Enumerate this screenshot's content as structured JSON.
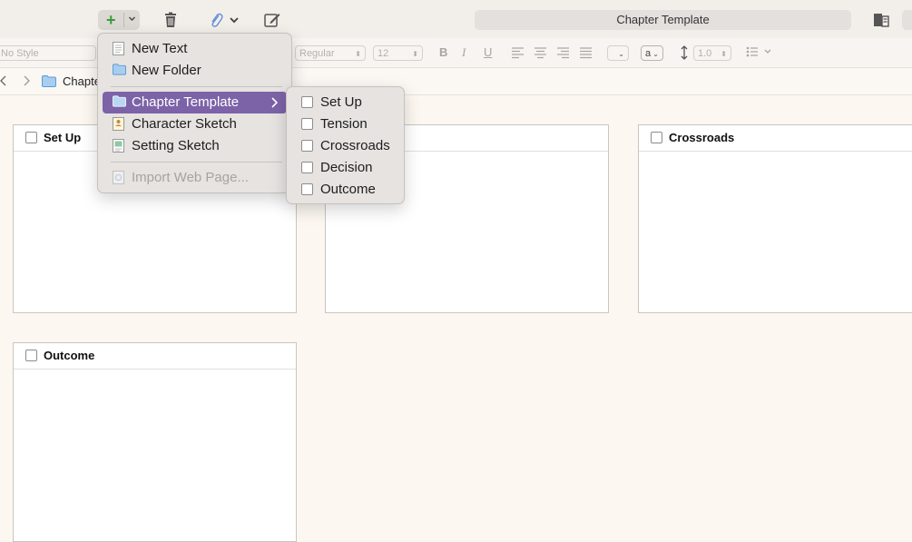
{
  "toolbar": {
    "add_icon": "plus-icon",
    "delete_icon": "trash-icon",
    "attach_icon": "paperclip-icon",
    "compose_icon": "compose-icon",
    "title": "Chapter Template",
    "inspector_icon": "inspector-icon"
  },
  "format_bar": {
    "style": "No Style",
    "font_weight": "Regular",
    "font_size": "12",
    "bold": "B",
    "italic": "I",
    "underline": "U",
    "text_color": "a",
    "line_spacing": "1.0"
  },
  "path_bar": {
    "crumb": "Chapte"
  },
  "cards": [
    {
      "title": "Set Up"
    },
    {
      "title": ""
    },
    {
      "title": "Crossroads"
    },
    {
      "title": "Outcome"
    }
  ],
  "add_menu": {
    "items": [
      {
        "label": "New Text",
        "icon": "document-icon"
      },
      {
        "label": "New Folder",
        "icon": "folder-icon"
      },
      {
        "label": "Chapter Template",
        "icon": "folder-icon",
        "highlighted": true
      },
      {
        "label": "Character Sketch",
        "icon": "character-sketch-icon"
      },
      {
        "label": "Setting Sketch",
        "icon": "setting-sketch-icon"
      },
      {
        "label": "Import Web Page...",
        "icon": "web-page-icon",
        "disabled": true
      }
    ]
  },
  "submenu": {
    "items": [
      {
        "label": "Set Up"
      },
      {
        "label": "Tension"
      },
      {
        "label": "Crossroads"
      },
      {
        "label": "Decision"
      },
      {
        "label": "Outcome"
      }
    ]
  },
  "colors": {
    "highlight": "#7c63a8",
    "background": "#fcf7f0",
    "add_green": "#3a9a3a"
  }
}
